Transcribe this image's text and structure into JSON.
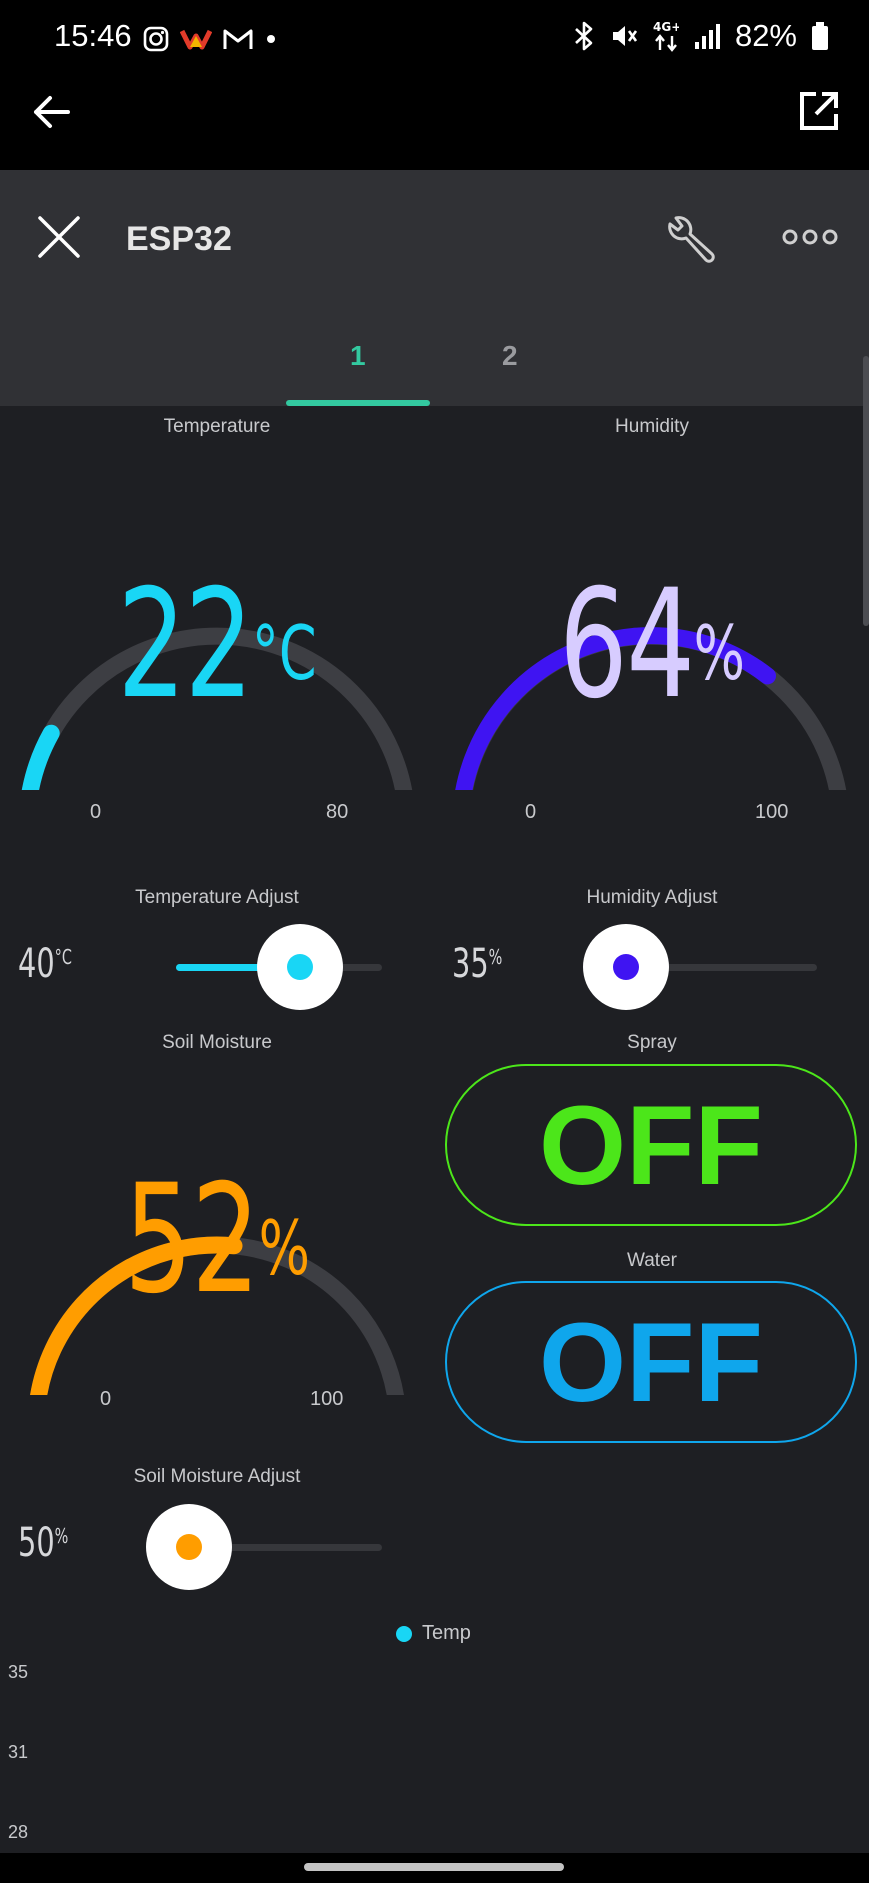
{
  "status_bar": {
    "time": "15:46",
    "battery": "82%",
    "icons_left": [
      "instagram-icon",
      "app-icon",
      "gmail-icon",
      "dot-icon"
    ],
    "icons_right": [
      "bluetooth-icon",
      "mute-icon",
      "network-4g-icon",
      "signal-icon",
      "battery-icon"
    ],
    "network_label": "4G+"
  },
  "app_bar": {
    "back_icon": "arrow-left-icon",
    "open_external_icon": "open-external-icon"
  },
  "device_header": {
    "title": "ESP32",
    "close_icon": "close-icon",
    "settings_icon": "wrench-icon",
    "more_icon": "more-icon",
    "tabs": [
      {
        "label": "1",
        "active": true
      },
      {
        "label": "2",
        "active": false
      }
    ],
    "accent": "#33c9a0"
  },
  "widgets": {
    "temperature": {
      "label": "Temperature",
      "value": "22",
      "unit": "°C",
      "min": "0",
      "max": "80",
      "fraction": 0.275,
      "color": "#19d6f5"
    },
    "humidity": {
      "label": "Humidity",
      "value": "64",
      "unit": "%",
      "min": "0",
      "max": "100",
      "fraction": 0.64,
      "color": "#3f14f2",
      "text_color": "#d7ccff"
    },
    "soil_moisture": {
      "label": "Soil Moisture",
      "value": "52",
      "unit": "%",
      "min": "0",
      "max": "100",
      "fraction": 0.52,
      "color": "#ff9d00"
    },
    "temperature_adjust": {
      "label": "Temperature Adjust",
      "value": "40",
      "unit": "°C",
      "fraction": 0.6,
      "color": "#19d6f5"
    },
    "humidity_adjust": {
      "label": "Humidity Adjust",
      "value": "35",
      "unit": "%",
      "fraction": 0.0,
      "color": "#3f14f2"
    },
    "soil_adjust": {
      "label": "Soil Moisture Adjust",
      "value": "50",
      "unit": "%",
      "fraction": 0.1,
      "color": "#ff9d00"
    },
    "spray": {
      "label": "Spray",
      "state": "OFF",
      "color": "#4ce61a"
    },
    "water": {
      "label": "Water",
      "state": "OFF",
      "color": "#0fa6ec"
    }
  },
  "chart": {
    "legend": [
      {
        "name": "Temp",
        "color": "#19d6f5"
      }
    ],
    "y_ticks": [
      "35",
      "31",
      "28"
    ]
  }
}
